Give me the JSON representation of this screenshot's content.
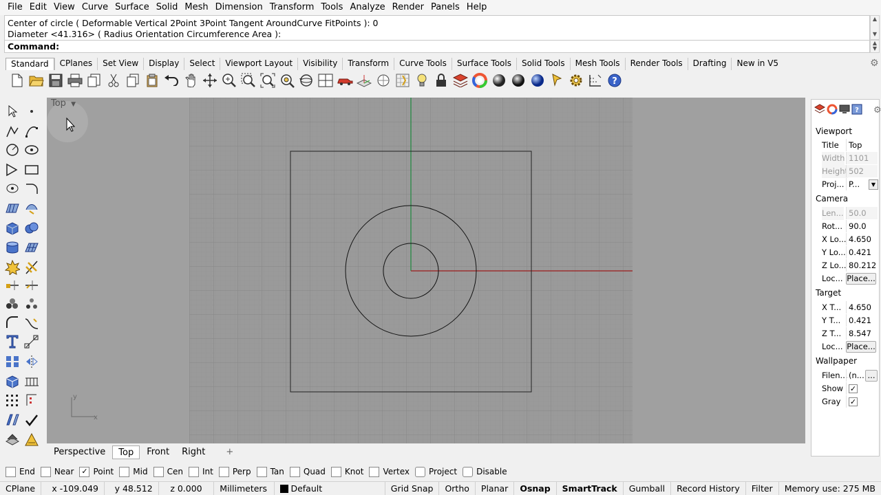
{
  "menu": [
    "File",
    "Edit",
    "View",
    "Curve",
    "Surface",
    "Solid",
    "Mesh",
    "Dimension",
    "Transform",
    "Tools",
    "Analyze",
    "Render",
    "Panels",
    "Help"
  ],
  "command": {
    "history_line1": "Center of circle ( Deformable  Vertical  2Point  3Point  Tangent  AroundCurve  FitPoints ): 0",
    "history_line2": "Diameter <41.316> ( Radius  Orientation  Circumference  Area ):",
    "prompt": "Command:"
  },
  "toolbar_tabs": [
    "Standard",
    "CPlanes",
    "Set View",
    "Display",
    "Select",
    "Viewport Layout",
    "Visibility",
    "Transform",
    "Curve Tools",
    "Surface Tools",
    "Solid Tools",
    "Mesh Tools",
    "Render Tools",
    "Drafting",
    "New in V5"
  ],
  "toolbar_icons": [
    "new-file-icon",
    "open-file-icon",
    "save-icon",
    "print-icon",
    "import-icon",
    "cut-icon",
    "copy-icon",
    "paste-icon",
    "undo-icon",
    "pan-icon",
    "move-view-icon",
    "zoom-icon",
    "zoom-window-icon",
    "zoom-extents-icon",
    "zoom-selected-icon",
    "rotate-view-icon",
    "four-views-icon",
    "car-icon",
    "cplane-icon",
    "grid-icon",
    "snap-icon",
    "lightbulb-icon",
    "lock-icon",
    "layers-icon",
    "color-wheel-icon",
    "shaded-sphere-icon",
    "rendered-sphere-icon",
    "blue-sphere-icon",
    "pin-icon",
    "gear-settings-icon",
    "options-icon",
    "help-icon"
  ],
  "viewport": {
    "title": "Top",
    "axis_x": "x",
    "axis_y": "y"
  },
  "view_tabs": [
    "Perspective",
    "Top",
    "Front",
    "Right"
  ],
  "view_tab_add": "+",
  "panel": {
    "sections": {
      "viewport": "Viewport",
      "camera": "Camera",
      "target": "Target",
      "wallpaper": "Wallpaper"
    },
    "rows": {
      "title": {
        "label": "Title",
        "value": "Top"
      },
      "width": {
        "label": "Width",
        "value": "1101"
      },
      "height": {
        "label": "Height",
        "value": "502"
      },
      "proj": {
        "label": "Proj...",
        "value": "P..."
      },
      "len": {
        "label": "Len...",
        "value": "50.0"
      },
      "rot": {
        "label": "Rot...",
        "value": "90.0"
      },
      "xloc": {
        "label": "X Lo...",
        "value": "4.650"
      },
      "yloc": {
        "label": "Y Lo...",
        "value": "0.421"
      },
      "zloc": {
        "label": "Z Lo...",
        "value": "80.212"
      },
      "loc1": {
        "label": "Loc...",
        "value": "Place..."
      },
      "xt": {
        "label": "X T...",
        "value": "4.650"
      },
      "yt": {
        "label": "Y T...",
        "value": "0.421"
      },
      "zt": {
        "label": "Z T...",
        "value": "8.547"
      },
      "loc2": {
        "label": "Loc...",
        "value": "Place..."
      },
      "filen": {
        "label": "Filen...",
        "value": "(n...",
        "button": "..."
      },
      "show": {
        "label": "Show",
        "checked": "✓"
      },
      "gray": {
        "label": "Gray",
        "checked": "✓"
      }
    }
  },
  "osnap": [
    {
      "label": "End",
      "checked": ""
    },
    {
      "label": "Near",
      "checked": ""
    },
    {
      "label": "Point",
      "checked": "✓"
    },
    {
      "label": "Mid",
      "checked": ""
    },
    {
      "label": "Cen",
      "checked": ""
    },
    {
      "label": "Int",
      "checked": ""
    },
    {
      "label": "Perp",
      "checked": ""
    },
    {
      "label": "Tan",
      "checked": ""
    },
    {
      "label": "Quad",
      "checked": ""
    },
    {
      "label": "Knot",
      "checked": ""
    },
    {
      "label": "Vertex",
      "checked": ""
    },
    {
      "label": "Project",
      "checked": ""
    },
    {
      "label": "Disable",
      "checked": ""
    }
  ],
  "status": {
    "cplane": "CPlane",
    "x": "x -109.049",
    "y": "y 48.512",
    "z": "z 0.000",
    "units": "Millimeters",
    "layer": "Default",
    "grid_snap": "Grid Snap",
    "ortho": "Ortho",
    "planar": "Planar",
    "osnap": "Osnap",
    "smarttrack": "SmartTrack",
    "gumball": "Gumball",
    "record_history": "Record History",
    "filter": "Filter",
    "memory": "Memory use: 275 MB"
  },
  "colors": {
    "viewport_bg": "#a0a0a0",
    "grid_minor": "#949494",
    "grid_major": "#848484",
    "axis_x": "#9b2f2f",
    "axis_y": "#2f8a4a",
    "curve": "#111111",
    "help_blue": "#3a63c8"
  }
}
